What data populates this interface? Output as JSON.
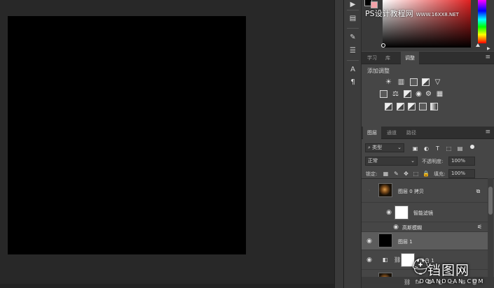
{
  "watermark_top": {
    "text": "PS设计教程网",
    "url": "WWW.16XX8.NET"
  },
  "tool_strip": {
    "icons": [
      "play-icon",
      "history-icon",
      "brush-icon",
      "sliders-icon",
      "character-icon",
      "paragraph-icon"
    ]
  },
  "adjustments": {
    "tabs": [
      "学习",
      "库",
      "调整"
    ],
    "active_tab": "调整",
    "title": "添加调整"
  },
  "layers": {
    "tabs": [
      "图层",
      "通道",
      "路径"
    ],
    "active_tab": "图层",
    "filter_kind": "类型",
    "blend_mode": "正常",
    "opacity_label": "不透明度:",
    "opacity_value": "100%",
    "lock_label": "锁定:",
    "fill_label": "填充:",
    "fill_value": "100%",
    "items": [
      {
        "name": "图层 0 拷贝",
        "visible": false
      },
      {
        "name": "智能滤镜",
        "visible": true
      },
      {
        "name": "高斯模糊",
        "visible": true
      },
      {
        "name": "图层 1",
        "visible": true,
        "selected": true
      },
      {
        "name": "黑白 1",
        "visible": true
      },
      {
        "name": "",
        "visible": true
      }
    ]
  },
  "watermark_bottom": {
    "title": "铛图网",
    "url": "DOANDOAN.COM"
  },
  "colors": {
    "canvas": "#000000",
    "workspace": "#282828",
    "panel": "#464646",
    "background_swatch": "#f3a2a8"
  }
}
